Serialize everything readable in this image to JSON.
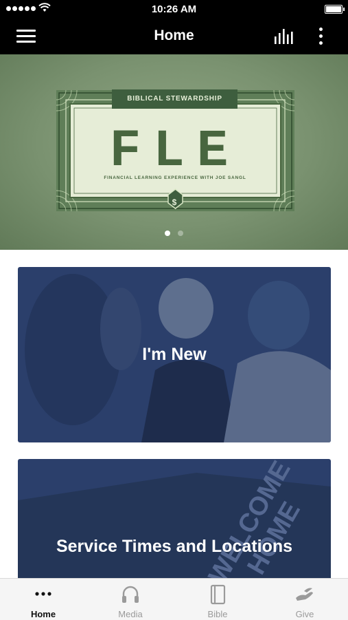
{
  "status_bar": {
    "time": "10:26 AM"
  },
  "navbar": {
    "title": "Home"
  },
  "hero": {
    "banner_tag": "BIBLICAL STEWARDSHIP",
    "banner_title": "FLE",
    "banner_subtitle": "FINANCIAL LEARNING EXPERIENCE WITH JOE SANGL",
    "seal_symbol": "$",
    "page_count": 2,
    "active_page": 1
  },
  "cards": [
    {
      "label": "I'm New"
    },
    {
      "label": "Service Times and Locations"
    }
  ],
  "tabs": [
    {
      "label": "Home",
      "icon": "more-dots-icon",
      "active": true
    },
    {
      "label": "Media",
      "icon": "headphones-icon",
      "active": false
    },
    {
      "label": "Bible",
      "icon": "book-icon",
      "active": false
    },
    {
      "label": "Give",
      "icon": "give-hand-icon",
      "active": false
    }
  ],
  "colors": {
    "nav_bg": "#000000",
    "card_overlay": "#2b3f6b",
    "active_tab": "#111111",
    "inactive_tab": "#9a9a9a"
  }
}
